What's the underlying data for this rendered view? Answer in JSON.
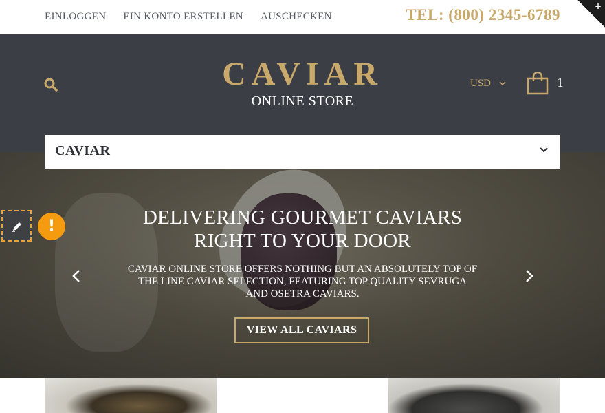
{
  "topbar": {
    "links": [
      "EINLOGGEN",
      "EIN KONTO ERSTELLEN",
      "AUSCHECKEN"
    ],
    "phone": "TEL: (800) 2345-6789"
  },
  "header": {
    "logo_title": "CAVIAR",
    "logo_subtitle": "ONLINE STORE",
    "currency": "USD",
    "cart_count": "1"
  },
  "category_bar": {
    "label": "CAVIAR"
  },
  "hero": {
    "title_line1": "DELIVERING GOURMET CAVIARS",
    "title_line2": "RIGHT TO YOUR DOOR",
    "text": "CAVIAR ONLINE STORE OFFERS NOTHING BUT AN ABSOLUTELY TOP OF THE LINE CAVIAR SELECTION, FEATURING TOP QUALITY SEVRUGA AND OSETRA CAVIARS.",
    "button": "VIEW ALL CAVIARS"
  },
  "widgets": {
    "alert_symbol": "!",
    "corner_symbol": "+"
  },
  "colors": {
    "accent_gold": "#c9a96b",
    "header_bg": "#3b3e44",
    "alert_orange": "#f59b10"
  }
}
